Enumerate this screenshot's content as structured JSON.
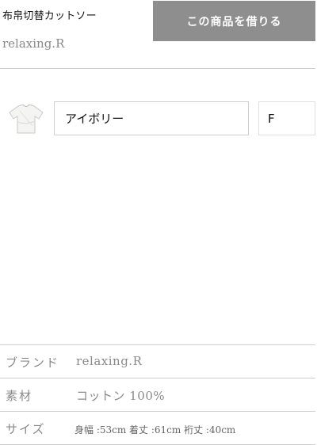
{
  "product": {
    "name": "布帛切替カットソー",
    "brand": "relaxing.R",
    "rent_button_label": "この商品を借りる"
  },
  "options": {
    "color": "アイボリー",
    "size": "F",
    "thumbnail_icon": "tshirt-icon"
  },
  "specs": [
    {
      "label": "ブランド",
      "value": "relaxing.R"
    },
    {
      "label": "素材",
      "value": "コットン 100%"
    },
    {
      "label": "サイズ",
      "value": "身幅 :53cm 着丈 :61cm 裄丈 :40cm"
    }
  ],
  "colors": {
    "button_bg": "#8e8e8e",
    "divider": "#cfcfcf",
    "muted_text": "#8a8a8a"
  }
}
